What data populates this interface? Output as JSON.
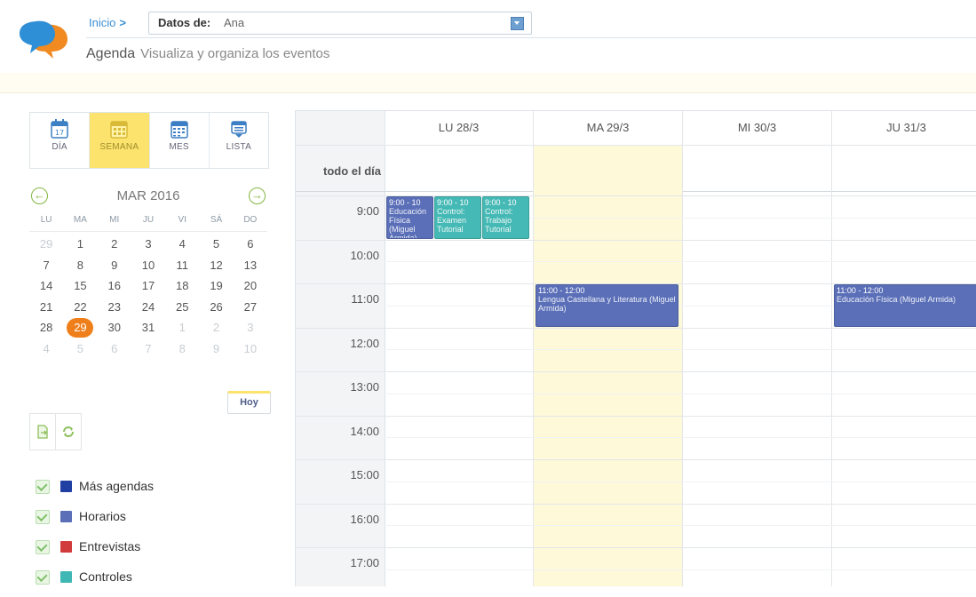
{
  "header": {
    "breadcrumb_home": "Inicio",
    "breadcrumb_sep": ">",
    "selector_label": "Datos de:",
    "selector_value": "Ana",
    "title": "Agenda",
    "subtitle": "Visualiza y organiza los eventos"
  },
  "views": {
    "day_label": "DÍA",
    "day_icon_number": "17",
    "week_label": "SEMANA",
    "month_label": "MES",
    "list_label": "LISTA",
    "active": "week"
  },
  "mini_calendar": {
    "month_label": "MAR 2016",
    "prev_symbol": "←",
    "next_symbol": "→",
    "weekdays": [
      "LU",
      "MA",
      "MI",
      "JU",
      "VI",
      "SÁ",
      "DO"
    ],
    "weeks": [
      [
        "29",
        "1",
        "2",
        "3",
        "4",
        "5",
        "6"
      ],
      [
        "7",
        "8",
        "9",
        "10",
        "11",
        "12",
        "13"
      ],
      [
        "14",
        "15",
        "16",
        "17",
        "18",
        "19",
        "20"
      ],
      [
        "21",
        "22",
        "23",
        "24",
        "25",
        "26",
        "27"
      ],
      [
        "28",
        "29",
        "30",
        "31",
        "1",
        "2",
        "3"
      ],
      [
        "4",
        "5",
        "6",
        "7",
        "8",
        "9",
        "10"
      ]
    ],
    "today": "29",
    "today_button": "Hoy"
  },
  "legend": [
    {
      "label": "Más agendas",
      "color": "#1f3fa3"
    },
    {
      "label": "Horarios",
      "color": "#5a6fb8"
    },
    {
      "label": "Entrevistas",
      "color": "#d13b3b"
    },
    {
      "label": "Controles",
      "color": "#3fb7b4"
    }
  ],
  "week": {
    "allday_label": "todo el día",
    "columns": [
      "LU 28/3",
      "MA 29/3",
      "MI 30/3",
      "JU 31/3"
    ],
    "today_column": 1,
    "hours": [
      "9:00",
      "10:00",
      "11:00",
      "12:00",
      "13:00",
      "14:00",
      "15:00",
      "16:00",
      "17:00"
    ],
    "events": [
      {
        "day": 0,
        "lane": 0,
        "lanes": 3,
        "start": 9,
        "end": 10,
        "time": "9:00 - 10",
        "title": "Educación Física (Miguel Armida)",
        "color": "#5a6fb8"
      },
      {
        "day": 0,
        "lane": 1,
        "lanes": 3,
        "start": 9,
        "end": 10,
        "time": "9:00 - 10",
        "title": "Control: Examen Tutorial",
        "color": "#45b9b5"
      },
      {
        "day": 0,
        "lane": 2,
        "lanes": 3,
        "start": 9,
        "end": 10,
        "time": "9:00 - 10",
        "title": "Control: Trabajo Tutorial",
        "color": "#45b9b5"
      },
      {
        "day": 1,
        "lane": 0,
        "lanes": 1,
        "start": 11,
        "end": 12,
        "time": "11:00 - 12:00",
        "title": "Lengua Castellana y Literatura (Miguel Armida)",
        "color": "#5a6fb8"
      },
      {
        "day": 3,
        "lane": 0,
        "lanes": 1,
        "start": 11,
        "end": 12,
        "time": "11:00 - 12:00",
        "title": "Educación Física (Miguel Armida)",
        "color": "#5a6fb8"
      }
    ]
  }
}
